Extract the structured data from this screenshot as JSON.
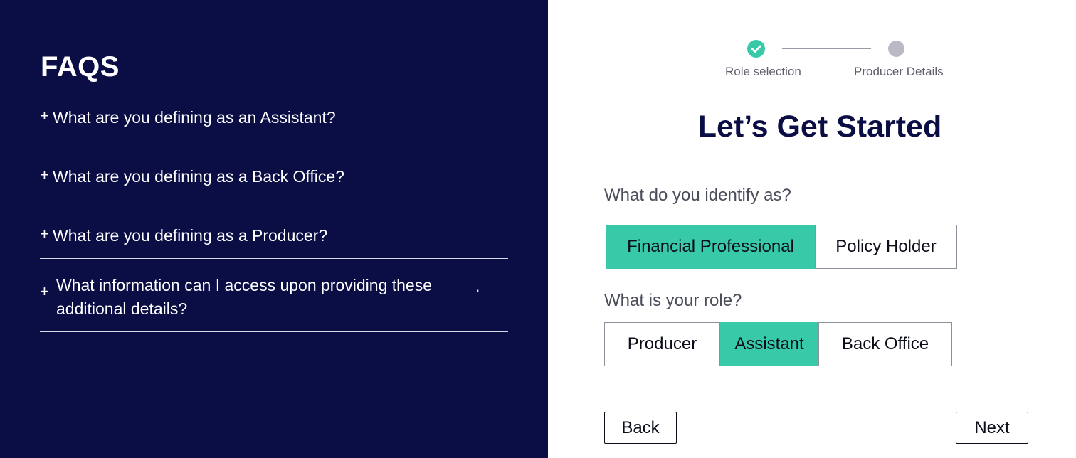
{
  "faq": {
    "title": "FAQS",
    "items": [
      {
        "plus": "+",
        "question": "What are you defining as an Assistant?"
      },
      {
        "plus": "+",
        "question": "What are you defining as a Back Office?"
      },
      {
        "plus": "+",
        "question": "What are you defining as a Producer?"
      },
      {
        "plus": "+",
        "question": "What information can I access upon providing these additional details?",
        "trailing": "."
      }
    ]
  },
  "stepper": {
    "steps": [
      {
        "label": "Role selection",
        "state": "complete",
        "icon": "check-icon"
      },
      {
        "label": "Producer Details",
        "state": "pending"
      }
    ]
  },
  "main": {
    "heading": "Let’s Get Started",
    "identify": {
      "prompt": "What do you identify as?",
      "options": [
        "Financial Professional",
        "Policy Holder"
      ],
      "selected": "Financial Professional"
    },
    "role": {
      "prompt": "What is your role?",
      "options": [
        "Producer",
        "Assistant",
        "Back Office"
      ],
      "selected": "Assistant"
    }
  },
  "actions": {
    "back_label": "Back",
    "next_label": "Next"
  },
  "colors": {
    "sidebar_bg": "#0b0d45",
    "accent": "#38c9a8",
    "heading": "#0b0d45",
    "pending_step": "#b9bac6"
  }
}
